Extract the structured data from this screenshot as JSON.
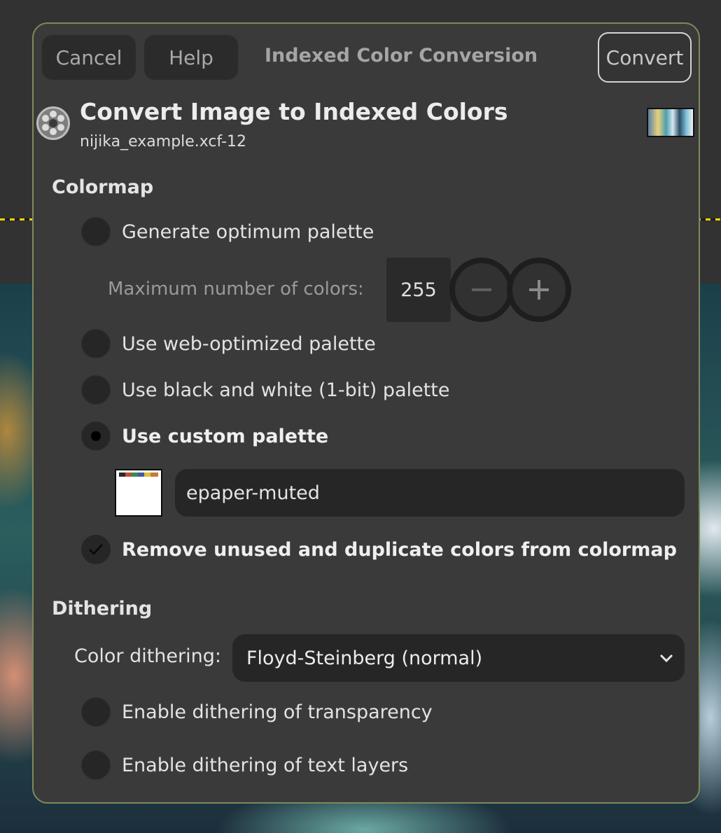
{
  "header": {
    "cancel_label": "Cancel",
    "help_label": "Help",
    "title": "Indexed Color Conversion",
    "convert_label": "Convert"
  },
  "dialog": {
    "title": "Convert Image to Indexed Colors",
    "subtitle": "nijika_example.xcf-12",
    "icon": "gimp-wilber-icon"
  },
  "colormap": {
    "heading": "Colormap",
    "options": [
      {
        "label": "Generate optimum palette",
        "selected": false
      },
      {
        "label": "Use web-optimized palette",
        "selected": false
      },
      {
        "label": "Use black and white (1-bit) palette",
        "selected": false
      },
      {
        "label": "Use custom palette",
        "selected": true
      }
    ],
    "max_colors_label": "Maximum number of colors:",
    "max_colors_value": "255",
    "custom_palette_name": "epaper-muted",
    "remove_unused": {
      "label": "Remove unused and duplicate colors from colormap",
      "checked": true
    }
  },
  "dithering": {
    "heading": "Dithering",
    "color_dithering_label": "Color dithering:",
    "color_dithering_value": "Floyd-Steinberg (normal)",
    "options": [
      {
        "label": "Enable dithering of transparency",
        "checked": false
      },
      {
        "label": "Enable dithering of text layers",
        "checked": false
      }
    ]
  },
  "colors": {
    "dialog_bg": "#3a3a3a",
    "dialog_border": "#7c8a5c",
    "control_bg": "#262626",
    "text": "#e3e3e3"
  }
}
